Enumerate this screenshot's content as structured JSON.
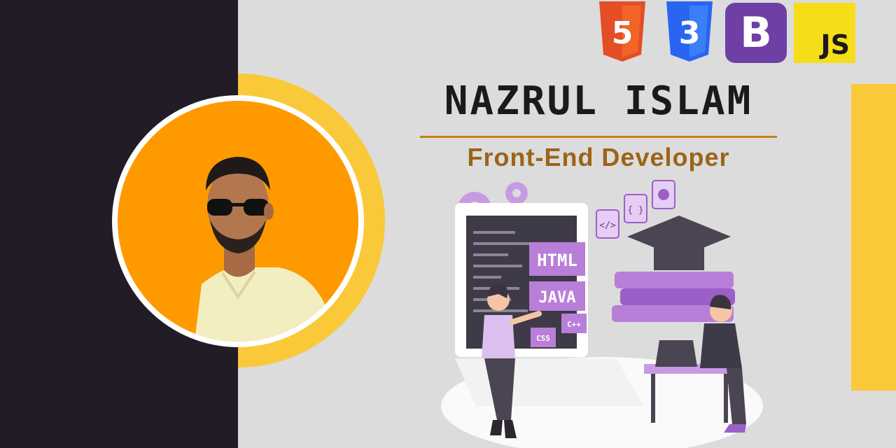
{
  "profile": {
    "name": "NAZRUL ISLAM",
    "role": "Front-End Developer"
  },
  "tech_badges": [
    {
      "id": "html5",
      "icon": "html5-icon",
      "label": "5",
      "color": "#e44d26"
    },
    {
      "id": "css3",
      "icon": "css3-icon",
      "label": "3",
      "color": "#2965f1"
    },
    {
      "id": "bootstrap",
      "icon": "bootstrap-icon",
      "label": "B",
      "color": "#6e3fa5"
    },
    {
      "id": "javascript",
      "icon": "javascript-icon",
      "label": "JS",
      "color": "#f5de19"
    }
  ],
  "illustration": {
    "screen_tags": [
      "HTML",
      "JAVA",
      "CSS",
      "C++"
    ],
    "code_icons": [
      "</>",
      "{ }"
    ]
  },
  "colors": {
    "dark_panel": "#221c26",
    "accent_yellow": "#f9c93a",
    "avatar_bg": "#fe9a00",
    "role_text": "#9c6418",
    "rule": "#c77f19",
    "illustration_purple": "#b97fd8"
  }
}
